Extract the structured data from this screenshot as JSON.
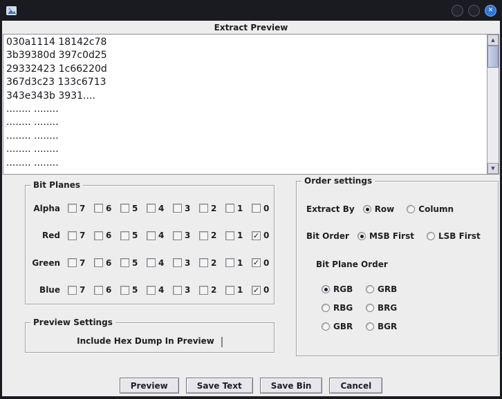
{
  "colors": {
    "titlebar_bg": "#1a1a21",
    "content_bg": "#ededed",
    "close_button_bg": "#2e76d8",
    "text_color": "#1f1f1f",
    "scroll_thumb": "#a9b2d2"
  },
  "icons": {
    "close_glyph": "✕",
    "scroll_up_glyph": "▲",
    "scroll_down_glyph": "▼",
    "check_glyph": "✓"
  },
  "header": {
    "title": "Extract Preview"
  },
  "preview_area": {
    "lines": [
      "030a1114 18142c78",
      "3b39380d 397c0d25",
      "29332423 1c66220d",
      "367d3c23 133c6713",
      "343e343b 3931....",
      "........ ........",
      "........ ........",
      "........ ........",
      "........ ........",
      "........ ........"
    ]
  },
  "bit_planes": {
    "title": "Bit Planes",
    "bit_labels": [
      "7",
      "6",
      "5",
      "4",
      "3",
      "2",
      "1",
      "0"
    ],
    "rows": [
      {
        "label": "Alpha",
        "checked_bits": []
      },
      {
        "label": "Red",
        "checked_bits": [
          "0"
        ]
      },
      {
        "label": "Green",
        "checked_bits": [
          "0"
        ]
      },
      {
        "label": "Blue",
        "checked_bits": [
          "0"
        ]
      }
    ]
  },
  "preview_settings": {
    "title": "Preview Settings",
    "include_hex_label": "Include Hex Dump In Preview",
    "include_hex_checked": false
  },
  "order_settings": {
    "title": "Order settings",
    "extract_by": {
      "label": "Extract By",
      "options": [
        "Row",
        "Column"
      ],
      "selected": "Row"
    },
    "bit_order": {
      "label": "Bit Order",
      "options": [
        "MSB First",
        "LSB First"
      ],
      "selected": "MSB First"
    },
    "bit_plane_order": {
      "label": "Bit Plane Order",
      "options": [
        "RGB",
        "GRB",
        "RBG",
        "BRG",
        "GBR",
        "BGR"
      ],
      "selected": "RGB"
    }
  },
  "buttons": {
    "preview": "Preview",
    "save_text": "Save Text",
    "save_bin": "Save Bin",
    "cancel": "Cancel"
  }
}
